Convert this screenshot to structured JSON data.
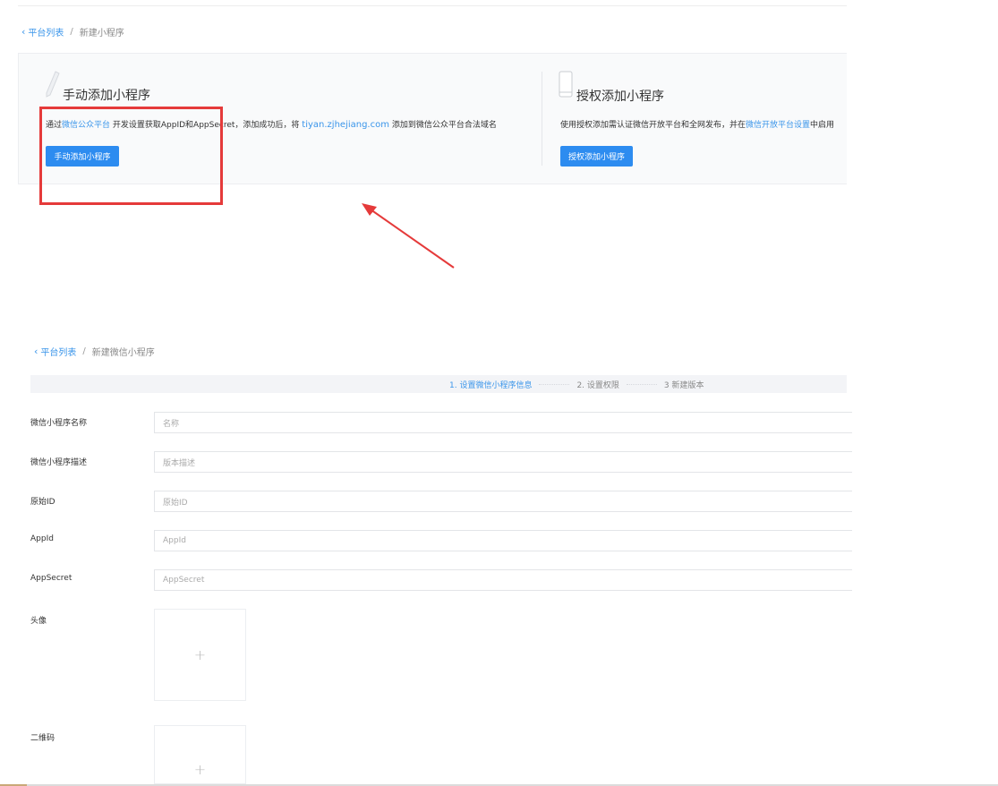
{
  "top_breadcrumb": {
    "back": "平台列表",
    "sep": "/",
    "current": "新建小程序"
  },
  "manual_card": {
    "title": "手动添加小程序",
    "desc_prefix": "通过",
    "desc_link": "微信公众平台",
    "desc_mid": " 开发设置获取AppID和AppSecret，添加成功后，将 ",
    "desc_url": "tiyan.zjhejiang.com",
    "desc_suffix": " 添加到微信公众平台合法域名",
    "button": "手动添加小程序",
    "icon": "pencil-icon"
  },
  "auth_card": {
    "title": "授权添加小程序",
    "desc_prefix": "使用授权添加需认证微信开放平台和全网发布，并在",
    "desc_link": "微信开放平台设置",
    "desc_suffix": "中启用",
    "button": "授权添加小程序",
    "icon": "phone-icon"
  },
  "annotation": {
    "highlight_color": "#e53a3a"
  },
  "form_breadcrumb": {
    "back": "平台列表",
    "sep": "/",
    "current": "新建微信小程序"
  },
  "steps": [
    {
      "label": "1. 设置微信小程序信息",
      "active": true
    },
    {
      "label": "2. 设置权限",
      "active": false
    },
    {
      "label": "3 新建版本",
      "active": false
    }
  ],
  "form": {
    "name": {
      "label": "微信小程序名称",
      "placeholder": "名称"
    },
    "desc": {
      "label": "微信小程序描述",
      "placeholder": "版本描述"
    },
    "original_id": {
      "label": "原始ID",
      "placeholder": "原始ID"
    },
    "appid": {
      "label": "AppId",
      "placeholder": "AppId"
    },
    "appsecret": {
      "label": "AppSecret",
      "placeholder": "AppSecret"
    },
    "avatar": {
      "label": "头像",
      "plus": "+"
    },
    "qrcode": {
      "label": "二维码",
      "plus": "+"
    }
  },
  "colors": {
    "accent": "#2d8cf0",
    "link": "#3a95ea",
    "annotation": "#e53a3a"
  }
}
